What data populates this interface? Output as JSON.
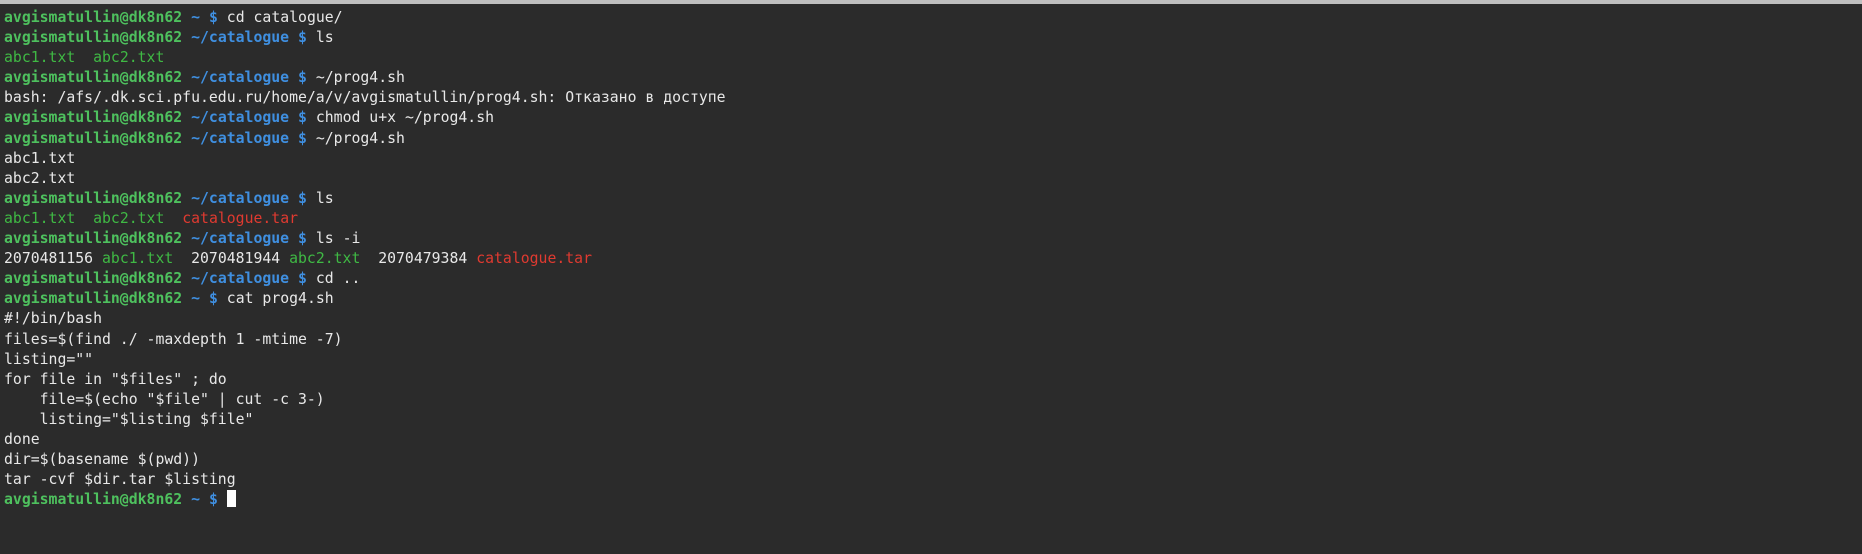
{
  "terminal": {
    "lines": [
      {
        "type": "prompt",
        "user": "avgismatullin@dk8n62",
        "path": "~",
        "cmd": "cd catalogue/"
      },
      {
        "type": "prompt",
        "user": "avgismatullin@dk8n62",
        "path": "~/catalogue",
        "cmd": "ls"
      },
      {
        "type": "output",
        "segments": [
          {
            "text": "abc1.txt",
            "kind": "exec"
          },
          {
            "text": "  "
          },
          {
            "text": "abc2.txt",
            "kind": "exec"
          }
        ]
      },
      {
        "type": "prompt",
        "user": "avgismatullin@dk8n62",
        "path": "~/catalogue",
        "cmd": "~/prog4.sh"
      },
      {
        "type": "output",
        "segments": [
          {
            "text": "bash: /afs/.dk.sci.pfu.edu.ru/home/a/v/avgismatullin/prog4.sh: Отказано в доступе"
          }
        ]
      },
      {
        "type": "prompt",
        "user": "avgismatullin@dk8n62",
        "path": "~/catalogue",
        "cmd": "chmod u+x ~/prog4.sh"
      },
      {
        "type": "prompt",
        "user": "avgismatullin@dk8n62",
        "path": "~/catalogue",
        "cmd": "~/prog4.sh"
      },
      {
        "type": "output",
        "segments": [
          {
            "text": "abc1.txt"
          }
        ]
      },
      {
        "type": "output",
        "segments": [
          {
            "text": "abc2.txt"
          }
        ]
      },
      {
        "type": "prompt",
        "user": "avgismatullin@dk8n62",
        "path": "~/catalogue",
        "cmd": "ls"
      },
      {
        "type": "output",
        "segments": [
          {
            "text": "abc1.txt",
            "kind": "exec"
          },
          {
            "text": "  "
          },
          {
            "text": "abc2.txt",
            "kind": "exec"
          },
          {
            "text": "  "
          },
          {
            "text": "catalogue.tar",
            "kind": "arch"
          }
        ]
      },
      {
        "type": "prompt",
        "user": "avgismatullin@dk8n62",
        "path": "~/catalogue",
        "cmd": "ls -i"
      },
      {
        "type": "output",
        "segments": [
          {
            "text": "2070481156 "
          },
          {
            "text": "abc1.txt",
            "kind": "exec"
          },
          {
            "text": "  2070481944 "
          },
          {
            "text": "abc2.txt",
            "kind": "exec"
          },
          {
            "text": "  2070479384 "
          },
          {
            "text": "catalogue.tar",
            "kind": "arch"
          }
        ]
      },
      {
        "type": "prompt",
        "user": "avgismatullin@dk8n62",
        "path": "~/catalogue",
        "cmd": "cd .."
      },
      {
        "type": "prompt",
        "user": "avgismatullin@dk8n62",
        "path": "~",
        "cmd": "cat prog4.sh"
      },
      {
        "type": "output",
        "segments": [
          {
            "text": "#!/bin/bash"
          }
        ]
      },
      {
        "type": "output",
        "segments": [
          {
            "text": "files=$(find ./ -maxdepth 1 -mtime -7)"
          }
        ]
      },
      {
        "type": "output",
        "segments": [
          {
            "text": "listing=\"\""
          }
        ]
      },
      {
        "type": "output",
        "segments": [
          {
            "text": "for file in \"$files\" ; do"
          }
        ]
      },
      {
        "type": "output",
        "segments": [
          {
            "text": "    file=$(echo \"$file\" | cut -c 3-)"
          }
        ]
      },
      {
        "type": "output",
        "segments": [
          {
            "text": "    listing=\"$listing $file\""
          }
        ]
      },
      {
        "type": "output",
        "segments": [
          {
            "text": "done"
          }
        ]
      },
      {
        "type": "output",
        "segments": [
          {
            "text": "dir=$(basename $(pwd))"
          }
        ]
      },
      {
        "type": "output",
        "segments": [
          {
            "text": "tar -cvf $dir.tar $listing"
          }
        ]
      },
      {
        "type": "prompt",
        "user": "avgismatullin@dk8n62",
        "path": "~",
        "cmd": "",
        "cursor": true
      }
    ],
    "prompt_symbol": "$",
    "colors": {
      "background": "#2b2b2b",
      "user": "#4ec15e",
      "path": "#3f8fe0",
      "text": "#e8e8e8",
      "exec_file": "#3fb944",
      "archive_file": "#e03a30"
    }
  }
}
